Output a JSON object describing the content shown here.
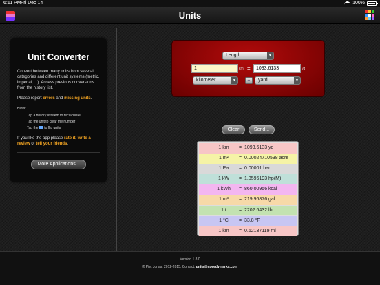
{
  "status_bar": {
    "time": "6:11 PM",
    "date": "Fri Dec 14",
    "battery": "100%"
  },
  "nav": {
    "title": "Units"
  },
  "left_panel": {
    "title": "Unit Converter",
    "intro": "Convert between many units from several categories and different unit systems (metric, imperial, ...). Access previous conversions from the history list.",
    "report_prefix": "Please report ",
    "report_errors": "errors",
    "report_and": " and ",
    "report_missing": "missing units",
    "report_suffix": ".",
    "hints_label": "Hints:",
    "hints": [
      "Tap a history list item to recalculate",
      "Tap the unit to clear the number",
      "Tap the",
      "to flip units"
    ],
    "like_prefix": "If you like the app please ",
    "like_rate": "rate it, write a review",
    "like_or": " or ",
    "like_tell": "tell your friends",
    "like_suffix": ".",
    "more_button": "More Applications..."
  },
  "converter": {
    "category": "Length",
    "input_value": "1",
    "input_unit_abbr": "km",
    "equals": "=",
    "output_value": "1093.6133",
    "output_unit_abbr": "yd",
    "from_unit": "kilometer",
    "to_unit": "yard",
    "swap_glyph": "⇔"
  },
  "actions": {
    "clear": "Clear",
    "send": "Send..."
  },
  "history": [
    {
      "lhs": "1 km",
      "rhs": "1093.6133 yd",
      "color": "#f7c6c6"
    },
    {
      "lhs": "1 m²",
      "rhs": "0.00024710538 acre",
      "color": "#f5f3a6"
    },
    {
      "lhs": "1 Pa",
      "rhs": "0.00001 bar",
      "color": "#d9d9d9"
    },
    {
      "lhs": "1 kW",
      "rhs": "1.3596193 hp(M)",
      "color": "#bfe0d9"
    },
    {
      "lhs": "1 kWh",
      "rhs": "860.00956 kcal",
      "color": "#f3b6f0"
    },
    {
      "lhs": "1 m³",
      "rhs": "219.96876 gal",
      "color": "#f7d9a8"
    },
    {
      "lhs": "1 t",
      "rhs": "2202.6432 lb",
      "color": "#c3e2b1"
    },
    {
      "lhs": "1 °C",
      "rhs": "33.8 °F",
      "color": "#c7c6f3"
    },
    {
      "lhs": "1 km",
      "rhs": "0.62137119 mi",
      "color": "#f7c6c6"
    }
  ],
  "footer": {
    "version": "Version 1.8.0",
    "copyright": "© Piet Jonas, 2012-2015. Contact: ",
    "email": "units@speedymarks.com"
  }
}
